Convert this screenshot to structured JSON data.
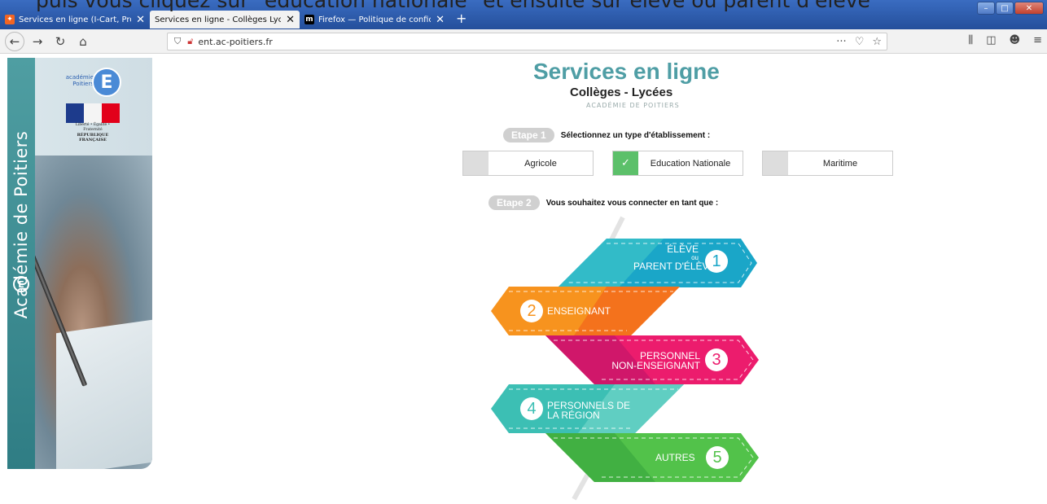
{
  "caption": "puis vous cliquez sur \"éducation nationale\" et ensuite sur élève ou parent d'élève",
  "browser": {
    "tabs": [
      {
        "label": "Services en ligne (I-Cart, ProNo",
        "active": false
      },
      {
        "label": "Services en ligne - Collèges Lycées",
        "active": true
      },
      {
        "label": "Firefox — Politique de confiden",
        "active": false
      }
    ],
    "new_tab": "+",
    "url": "ent.ac-poitiers.fr",
    "page_actions": "···"
  },
  "sidebar": {
    "vertical_title": "Académie de Poitiers",
    "academie_logo_text": "académie Poitiers",
    "academie_logo_letter": "E",
    "rf_motto": "Liberté • Égalité • Fraternité",
    "rf_name": "RÉPUBLIQUE FRANÇAISE"
  },
  "header": {
    "title": "Services en ligne",
    "subtitle": "Collèges - Lycées",
    "academy": "ACADÉMIE DE POITIERS"
  },
  "step1": {
    "pill": "Etape 1",
    "text": "Sélectionnez un type d'établissement :",
    "options": [
      {
        "label": "Agricole",
        "selected": false
      },
      {
        "label": "Education Nationale",
        "selected": true
      },
      {
        "label": "Maritime",
        "selected": false
      }
    ],
    "check": "✓"
  },
  "step2": {
    "pill": "Etape 2",
    "text": "Vous souhaitez vous connecter en tant que :",
    "choices": [
      {
        "num": "1",
        "line1": "ÉLÈVE",
        "small": "ou",
        "line2": "PARENT D'ÉLÈVE",
        "color": "#1aa6c8"
      },
      {
        "num": "2",
        "line1": "ENSEIGNANT",
        "color": "#f7931e"
      },
      {
        "num": "3",
        "line1": "PERSONNEL",
        "line2": "NON-ENSEIGNANT",
        "color": "#ec1c6d"
      },
      {
        "num": "4",
        "line1": "PERSONNELS DE",
        "line2": "LA RÉGION",
        "color": "#3cbfb4"
      },
      {
        "num": "5",
        "line1": "AUTRES",
        "color": "#52c24a"
      }
    ]
  }
}
